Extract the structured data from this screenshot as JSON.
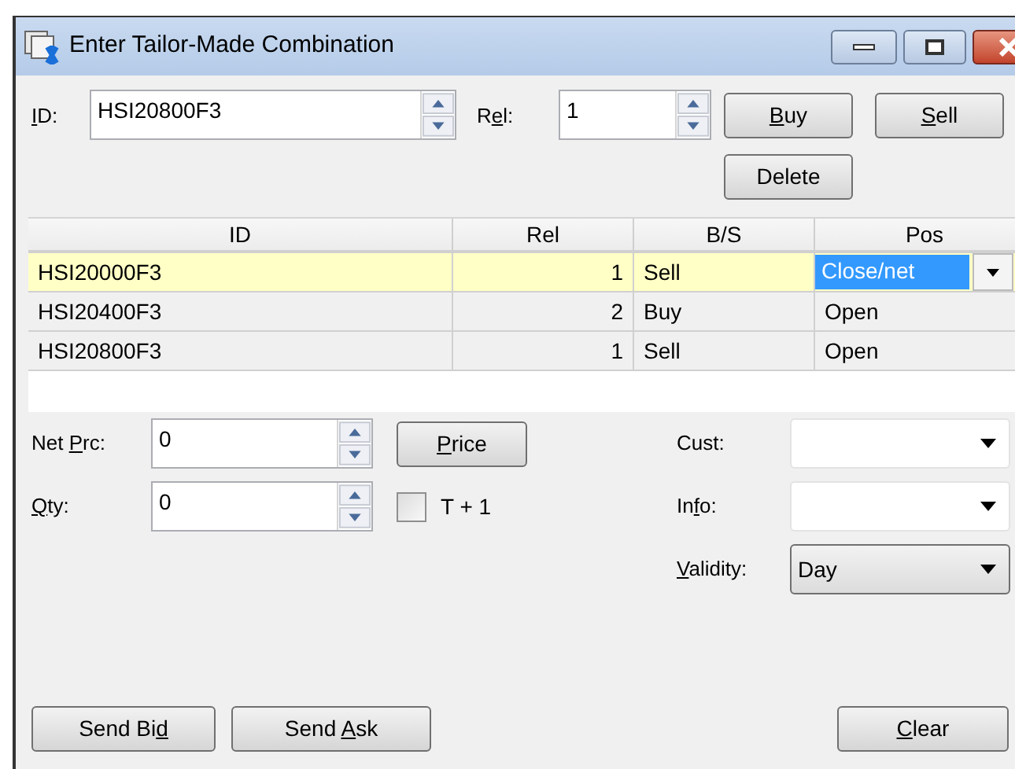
{
  "window": {
    "title": "Enter Tailor-Made Combination"
  },
  "id_field": {
    "label": {
      "key": "I",
      "post": "D:"
    },
    "value": "HSI20800F3"
  },
  "rel_field": {
    "label": {
      "pre": "R",
      "key": "e",
      "post": "l:"
    },
    "value": "1"
  },
  "top_buttons": [
    {
      "key": "B",
      "post": "uy"
    },
    {
      "key": "S",
      "post": "ell"
    }
  ],
  "delete_button": {
    "pre": "Delete"
  },
  "table": {
    "columns": [
      "ID",
      "Rel",
      "B/S",
      "Pos"
    ],
    "rows": [
      {
        "cells": [
          "HSI20000F3",
          "1",
          "Sell",
          "Close/net"
        ],
        "selected": true
      },
      {
        "cells": [
          "HSI20400F3",
          "2",
          "Buy",
          "Open"
        ],
        "selected": false
      },
      {
        "cells": [
          "HSI20800F3",
          "1",
          "Sell",
          "Open"
        ],
        "selected": false
      }
    ]
  },
  "net_price": {
    "label": {
      "pre": "Net ",
      "key": "P",
      "post": "rc:"
    },
    "value": "0"
  },
  "price_button": {
    "key": "P",
    "post": "rice"
  },
  "qty": {
    "label": {
      "key": "Q",
      "post": "ty:"
    },
    "value": "0"
  },
  "t_plus_1": {
    "label": "T + 1",
    "checked": false
  },
  "cust": {
    "label": {
      "pre": "Cust:"
    }
  },
  "info": {
    "label": {
      "pre": "In",
      "key": "f",
      "post": "o:"
    }
  },
  "validity": {
    "label": {
      "key": "V",
      "post": "alidity:"
    },
    "value": "Day"
  },
  "bottom_buttons": [
    {
      "pre": "Send Bi",
      "key": "d"
    },
    {
      "pre": "Send ",
      "key": "A",
      "post": "sk"
    }
  ],
  "clear_button": {
    "key": "C",
    "post": "lear"
  }
}
